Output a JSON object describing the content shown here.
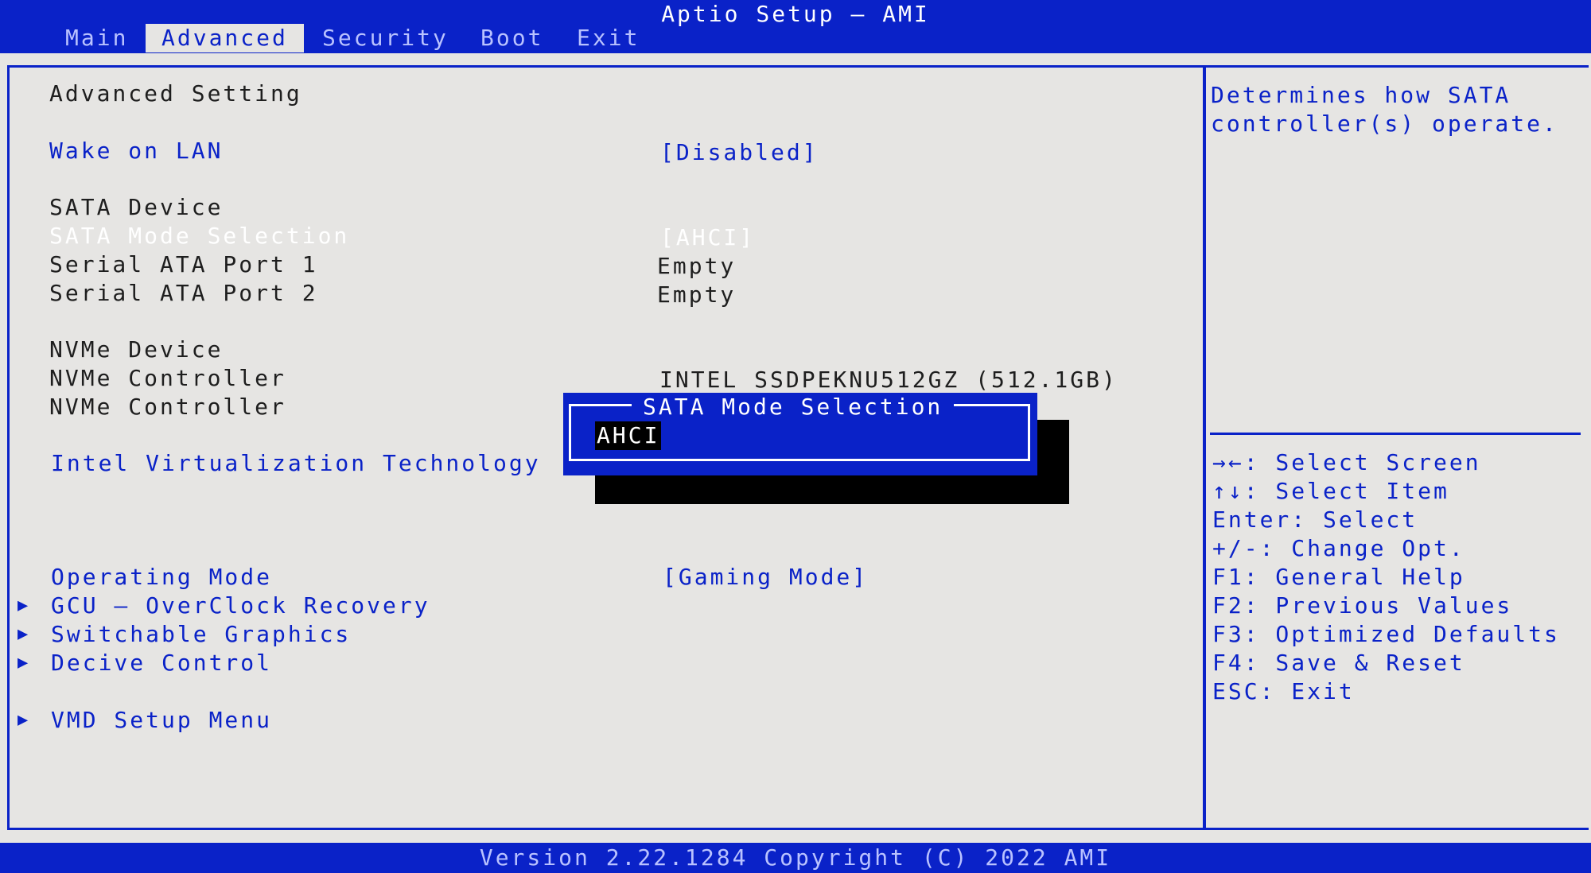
{
  "app": {
    "title": "Aptio Setup – AMI"
  },
  "tabs": [
    "Main",
    "Advanced",
    "Security",
    "Boot",
    "Exit"
  ],
  "main": {
    "heading": "Advanced Setting",
    "wake_on_lan": {
      "label": "Wake on LAN",
      "value": "[Disabled]"
    },
    "sata_device": "SATA Device",
    "sata_mode": {
      "label": "SATA Mode Selection",
      "value": "[AHCI]"
    },
    "sata_port1": {
      "label": "Serial ATA Port 1",
      "value": "Empty"
    },
    "sata_port2": {
      "label": "Serial ATA Port 2",
      "value": "Empty"
    },
    "nvme_device": "NVMe Device",
    "nvme_controller1": {
      "label": "NVMe Controller",
      "value": "INTEL SSDPEKNU512GZ (512.1GB)"
    },
    "nvme_controller2": {
      "label": "NVMe Controller"
    },
    "intel_vt": {
      "label": "Intel Virtualization Technology"
    },
    "operating_mode": {
      "label": "Operating Mode",
      "value": "[Gaming Mode]"
    },
    "submenus": [
      "GCU – OverClock Recovery",
      "Switchable Graphics",
      "Decive Control"
    ],
    "vmd": "VMD Setup Menu"
  },
  "help": {
    "description": [
      "Determines how SATA",
      "controller(s) operate."
    ],
    "keys": [
      "→←: Select Screen",
      "↑↓: Select Item",
      "Enter: Select",
      "+/-: Change Opt.",
      "F1: General Help",
      "F2: Previous Values",
      "F3: Optimized Defaults",
      "F4: Save & Reset",
      "ESC: Exit"
    ]
  },
  "popup": {
    "title": "SATA Mode Selection",
    "options": [
      "AHCI"
    ]
  },
  "footer": {
    "version": "Version 2.22.1284 Copyright (C) 2022 AMI"
  },
  "colors": {
    "bios_blue": "#0a22c8",
    "background": "#e6e5e3",
    "text": "#1e1e1e",
    "highlight": "#ffffff"
  },
  "icons": {
    "submenu": "triangle-right"
  }
}
